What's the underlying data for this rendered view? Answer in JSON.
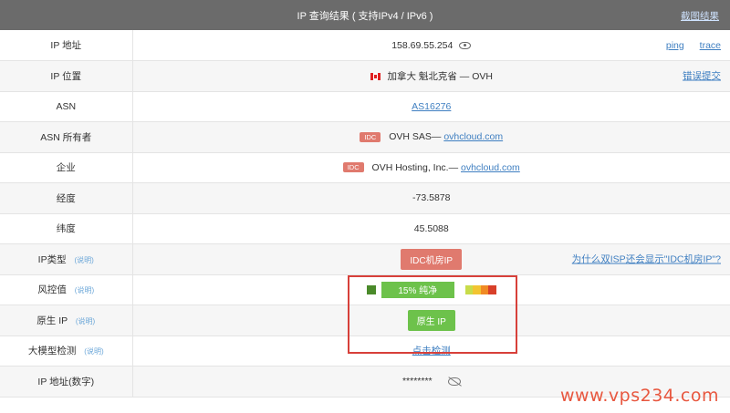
{
  "header": {
    "title": "IP 查询结果 ( 支持IPv4 / IPv6 )",
    "share": "截图结果"
  },
  "rows": {
    "ip": {
      "label": "IP 地址",
      "value": "158.69.55.254",
      "ping": "ping",
      "trace": "trace"
    },
    "location": {
      "label": "IP 位置",
      "value": "加拿大 魁北克省 — OVH",
      "report": "错误提交"
    },
    "asn": {
      "label": "ASN",
      "value": "AS16276"
    },
    "asn_owner": {
      "label": "ASN 所有者",
      "tag": "IDC",
      "name": "OVH SAS—",
      "link": "ovhcloud.com"
    },
    "company": {
      "label": "企业",
      "tag": "IDC",
      "name": "OVH Hosting, Inc.—",
      "link": "ovhcloud.com"
    },
    "longitude": {
      "label": "经度",
      "value": "-73.5878"
    },
    "latitude": {
      "label": "纬度",
      "value": "45.5088"
    },
    "ip_type": {
      "label": "IP类型",
      "help": "(说明)",
      "badge": "IDC机房IP",
      "why": "为什么双ISP还会显示\"IDC机房IP\"?"
    },
    "risk": {
      "label": "风控值",
      "help": "(说明)",
      "value": "15%  纯净",
      "percent": 15
    },
    "native": {
      "label": "原生 IP",
      "help": "(说明)",
      "badge": "原生 IP"
    },
    "llm": {
      "label": "大模型检测",
      "help": "(说明)",
      "link": "点击检测"
    },
    "ip_number": {
      "label": "IP 地址(数字)",
      "value": "********"
    }
  },
  "colors": {
    "accent": "#3f7fc1",
    "idc": "#e07a6e",
    "clean": "#6dc24b",
    "highlight": "#d7403a",
    "header": "#6b6b6b"
  },
  "risk_scale": [
    "#c8dc4a",
    "#f2c431",
    "#f08a24",
    "#d8402a"
  ],
  "watermark": "www.vps234.com"
}
